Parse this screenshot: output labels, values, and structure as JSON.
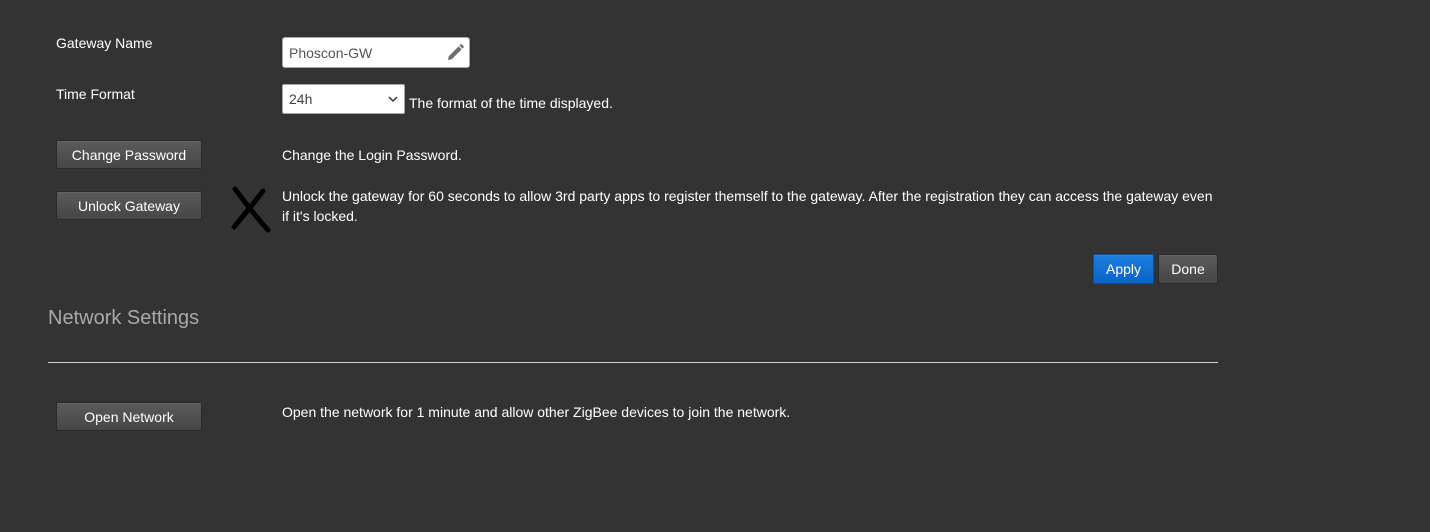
{
  "gateway": {
    "name_label": "Gateway Name",
    "name_value": "Phoscon-GW",
    "time_format_label": "Time Format",
    "time_format_value": "24h",
    "time_format_desc": "The format of the time displayed.",
    "change_password_button": "Change Password",
    "change_password_desc": "Change the Login Password.",
    "unlock_button": "Unlock Gateway",
    "unlock_desc": "Unlock the gateway for 60 seconds to allow 3rd party apps to register themself to the gateway. After the registration they can access the gateway even if it's locked.",
    "unlock_status_icon": "x-mark-icon"
  },
  "actions": {
    "apply_label": "Apply",
    "done_label": "Done"
  },
  "network": {
    "title": "Network Settings",
    "open_button": "Open Network",
    "open_desc": "Open the network for 1 minute and allow other ZigBee devices to join the network."
  },
  "colors": {
    "background": "#333333",
    "primary_button": "#0a63c6",
    "section_title": "#a9a9a9"
  }
}
